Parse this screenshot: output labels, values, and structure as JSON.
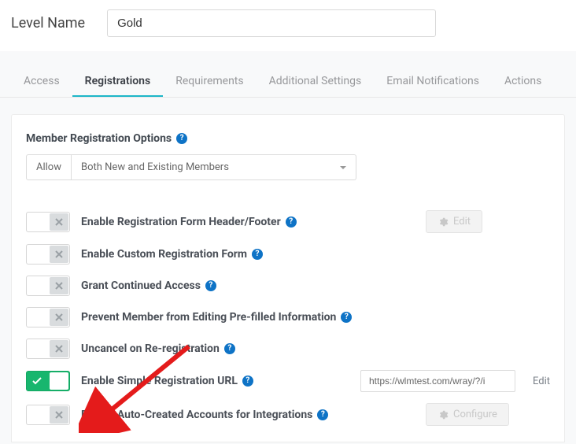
{
  "header": {
    "label": "Level Name",
    "value": "Gold"
  },
  "tabs": [
    {
      "label": "Access",
      "active": false
    },
    {
      "label": "Registrations",
      "active": true
    },
    {
      "label": "Requirements",
      "active": false
    },
    {
      "label": "Additional Settings",
      "active": false
    },
    {
      "label": "Email Notifications",
      "active": false
    },
    {
      "label": "Actions",
      "active": false
    }
  ],
  "section": {
    "title": "Member Registration Options",
    "allow_label": "Allow",
    "allow_value": "Both New and Existing Members"
  },
  "options": [
    {
      "label": "Enable Registration Form Header/Footer",
      "on": false,
      "action": "edit_btn"
    },
    {
      "label": "Enable Custom Registration Form",
      "on": false,
      "action": null
    },
    {
      "label": "Grant Continued Access",
      "on": false,
      "action": null
    },
    {
      "label": "Prevent Member from Editing Pre-filled Information",
      "on": false,
      "action": null
    },
    {
      "label": "Uncancel on Re-registration",
      "on": false,
      "action": null
    },
    {
      "label": "Enable Simple Registration URL",
      "on": true,
      "action": "url",
      "url": "https://wlmtest.com/wray/?/i"
    },
    {
      "label": "Enable Auto-Created Accounts for Integrations",
      "on": false,
      "action": "configure_btn"
    }
  ],
  "buttons": {
    "edit": "Edit",
    "configure": "Configure",
    "edit_link": "Edit"
  }
}
